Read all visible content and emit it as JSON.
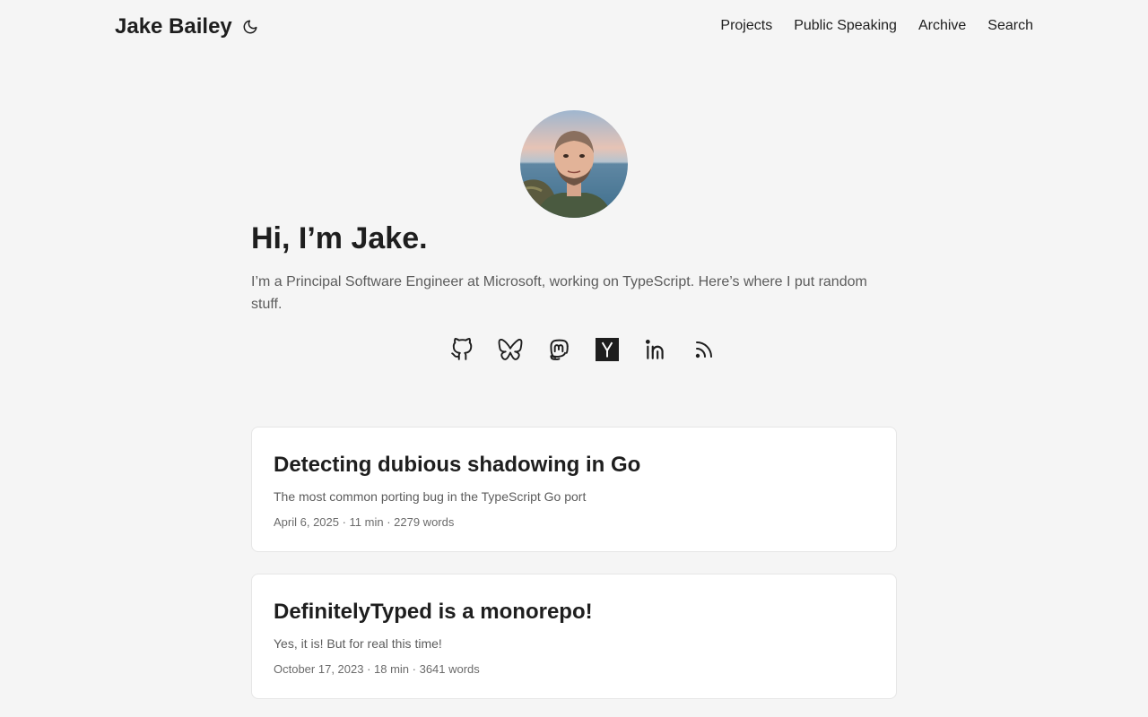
{
  "header": {
    "site_title": "Jake Bailey",
    "theme_toggle_icon": "moon-icon",
    "nav": [
      "Projects",
      "Public Speaking",
      "Archive",
      "Search"
    ]
  },
  "profile": {
    "title": "Hi, I’m Jake.",
    "description": "I’m a Principal Software Engineer at Microsoft, working on TypeScript. Here’s where I put random stuff.",
    "social_icons": [
      "github-icon",
      "bluesky-icon",
      "mastodon-icon",
      "hacker-news-icon",
      "linkedin-icon",
      "rss-icon"
    ]
  },
  "posts": [
    {
      "title": "Detecting dubious shadowing in Go",
      "summary": "The most common porting bug in the TypeScript Go port",
      "meta": "April 6, 2025 · 11 min · 2279 words"
    },
    {
      "title": "DefinitelyTyped is a monorepo!",
      "summary": "Yes, it is! But for real this time!",
      "meta": "October 17, 2023 · 18 min · 3641 words"
    }
  ]
}
